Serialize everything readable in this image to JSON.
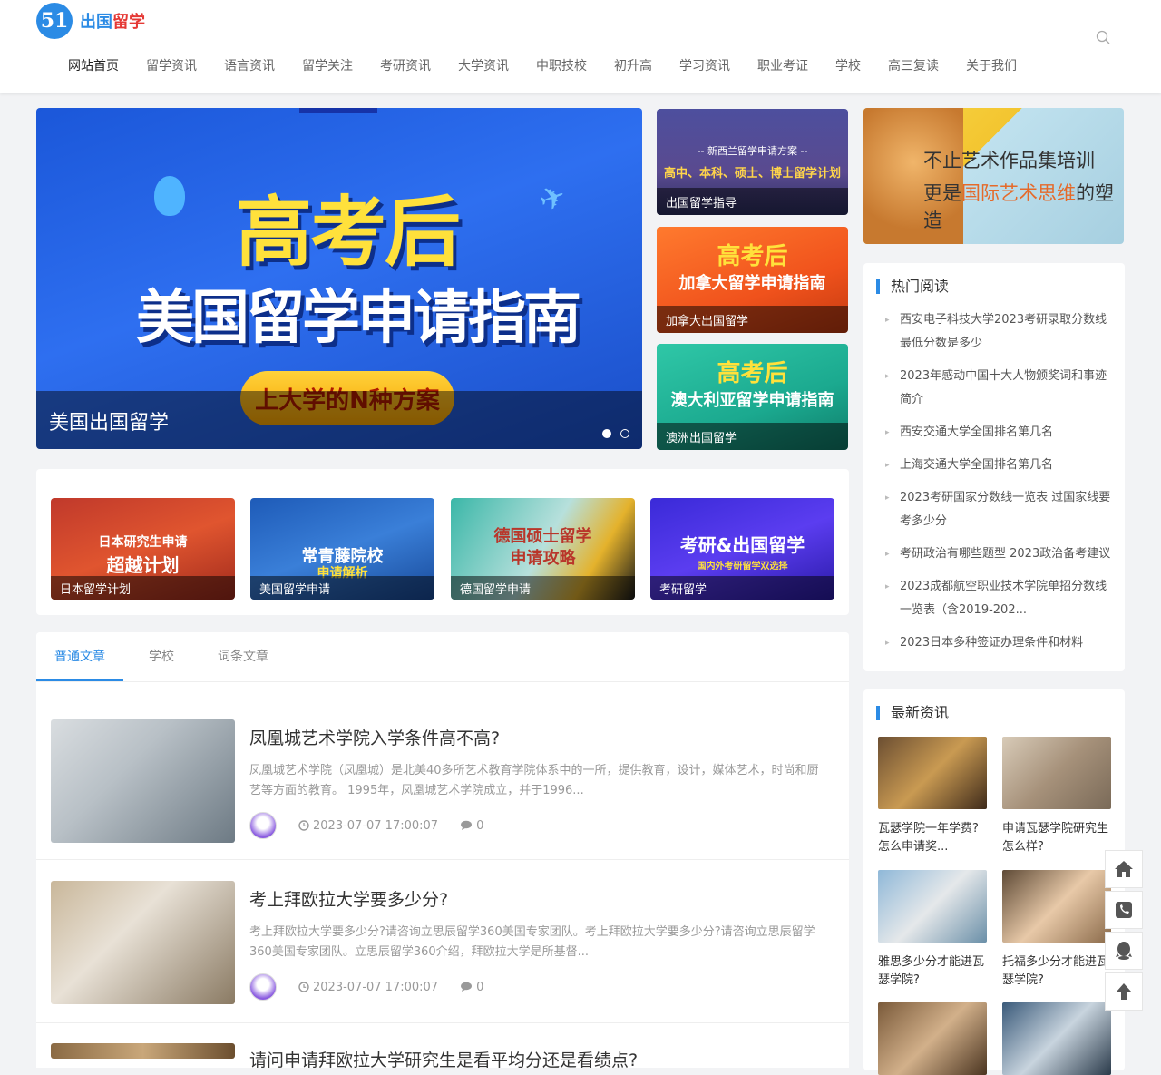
{
  "header": {
    "logo_badge": "51",
    "logo_part1": "出国",
    "logo_part2": "留学"
  },
  "nav": [
    "网站首页",
    "留学资讯",
    "语言资讯",
    "留学关注",
    "考研资讯",
    "大学资讯",
    "中职技校",
    "初升高",
    "学习资讯",
    "职业考证",
    "学校",
    "高三复读",
    "关于我们"
  ],
  "slider": {
    "hero_line1": "高考后",
    "hero_line2": "美国留学申请指南",
    "pill_text": "上大学的N种方案",
    "caption": "美国出国留学"
  },
  "side_thumbs": [
    {
      "caption": "出国留学指导",
      "title": "-- 新西兰留学申请方案 --",
      "subtitle": "高中、本科、硕士、博士留学计划"
    },
    {
      "caption": "加拿大出国留学",
      "title": "高考后",
      "subtitle": "加拿大留学申请指南"
    },
    {
      "caption": "澳洲出国留学",
      "title": "高考后",
      "subtitle": "澳大利亚留学申请指南"
    }
  ],
  "ad": {
    "line1": "不止艺术作品集培训",
    "line2_prefix": "更是",
    "line2_highlight": "国际艺术思维",
    "line2_suffix": "的塑造"
  },
  "categories": [
    {
      "caption": "日本留学计划",
      "art": "日本研究生申请",
      "art2": "超越计划"
    },
    {
      "caption": "美国留学申请",
      "art": "常青藤院校",
      "art2": "申请解析"
    },
    {
      "caption": "德国留学申请",
      "art": "德国硕士留学",
      "art2": "申请攻略"
    },
    {
      "caption": "考研留学",
      "art": "考研&出国留学",
      "art2": "国内外考研留学双选择"
    }
  ],
  "tabs": [
    "普通文章",
    "学校",
    "词条文章"
  ],
  "articles": [
    {
      "title": "凤凰城艺术学院入学条件高不高?",
      "excerpt": "凤凰城艺术学院（凤凰城）是北美40多所艺术教育学院体系中的一所，提供教育，设计，媒体艺术，时尚和厨艺等方面的教育。 1995年，凤凰城艺术学院成立，并于1996...",
      "date": "2023-07-07 17:00:07",
      "comments": "0"
    },
    {
      "title": "考上拜欧拉大学要多少分?",
      "excerpt": "考上拜欧拉大学要多少分?请咨询立思辰留学360美国专家团队。考上拜欧拉大学要多少分?请咨询立思辰留学360美国专家团队。立思辰留学360介绍，拜欧拉大学是所基督...",
      "date": "2023-07-07 17:00:07",
      "comments": "0"
    },
    {
      "title": "请问申请拜欧拉大学研究生是看平均分还是看绩点?"
    }
  ],
  "hot": {
    "title": "热门阅读",
    "items": [
      "西安电子科技大学2023考研录取分数线最低分数是多少",
      "2023年感动中国十大人物颁奖词和事迹简介",
      "西安交通大学全国排名第几名",
      "上海交通大学全国排名第几名",
      "2023考研国家分数线一览表 过国家线要考多少分",
      "考研政治有哪些题型 2023政治备考建议",
      "2023成都航空职业技术学院单招分数线一览表（含2019-202...",
      "2023日本多种签证办理条件和材料"
    ]
  },
  "latest": {
    "title": "最新资讯",
    "items": [
      "瓦瑟学院一年学费?怎么申请奖...",
      "申请瓦瑟学院研究生怎么样?",
      "雅思多少分才能进瓦瑟学院?",
      "托福多少分才能进瓦瑟学院?"
    ]
  },
  "icons": {
    "search": "search-icon",
    "clock": "clock-icon",
    "comment": "comment-icon",
    "home": "home-icon",
    "phone": "phone-icon",
    "qq": "qq-icon",
    "top": "arrow-up-icon"
  },
  "colors": {
    "accent": "#2b8be5",
    "logo_red": "#e53935"
  }
}
